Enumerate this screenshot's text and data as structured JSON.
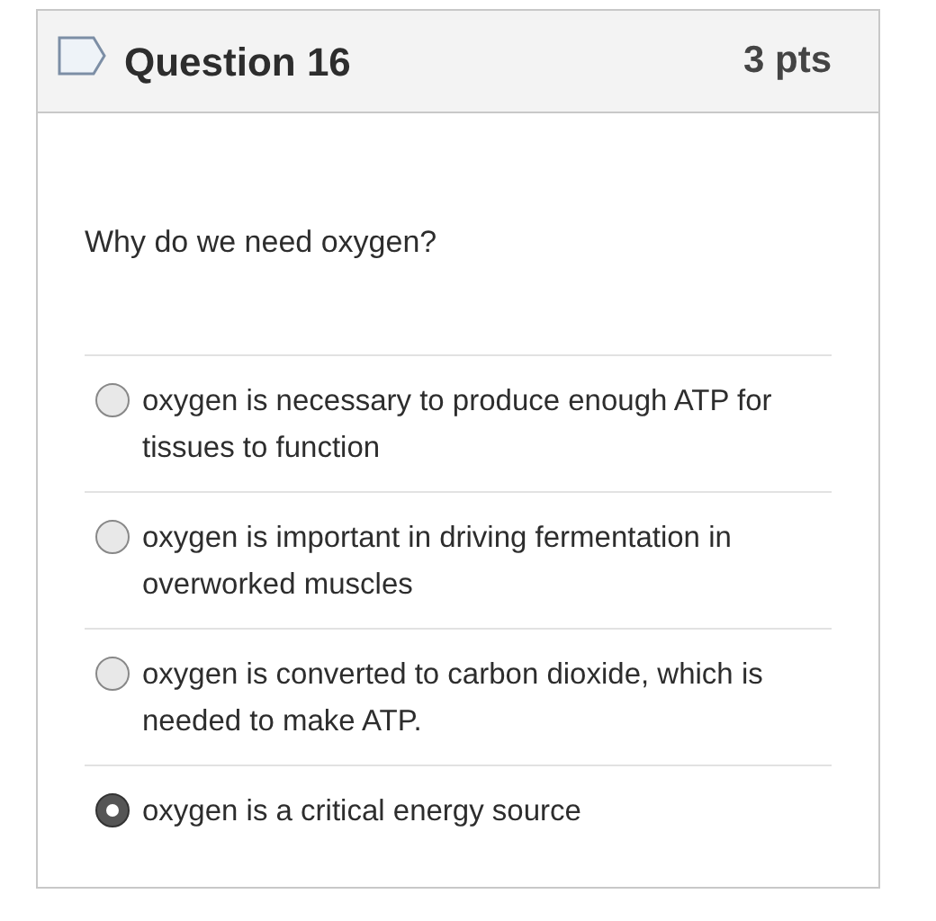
{
  "question": {
    "title": "Question 16",
    "points": "3 pts",
    "text": "Why do we need oxygen?"
  },
  "options": [
    {
      "label": "oxygen is necessary to produce enough ATP for tissues to function",
      "selected": false
    },
    {
      "label": "oxygen is important in driving fermentation in overworked muscles",
      "selected": false
    },
    {
      "label": "oxygen is converted to carbon dioxide, which is needed to make ATP.",
      "selected": false
    },
    {
      "label": "oxygen is a critical energy source",
      "selected": true
    }
  ]
}
